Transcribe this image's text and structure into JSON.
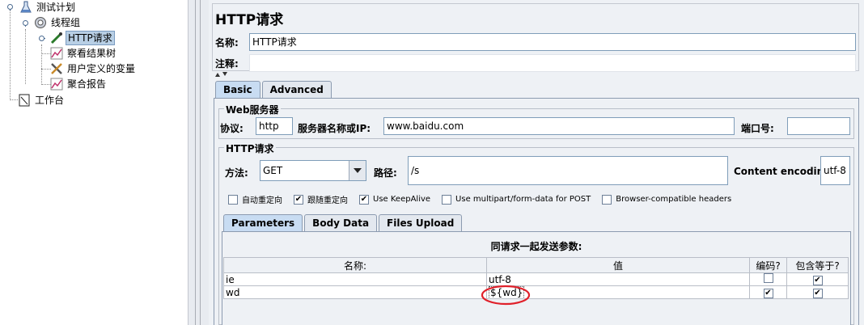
{
  "tree": {
    "items": [
      {
        "label": "测试计划",
        "icon": "flask-icon"
      },
      {
        "label": "线程组",
        "icon": "gear-icon"
      },
      {
        "label": "HTTP请求",
        "icon": "pipette-icon"
      },
      {
        "label": "察看结果树",
        "icon": "graph-icon"
      },
      {
        "label": "用户定义的变量",
        "icon": "tools-icon"
      },
      {
        "label": "聚合报告",
        "icon": "graph-icon"
      },
      {
        "label": "工作台",
        "icon": "clipboard-icon"
      }
    ]
  },
  "panel": {
    "title": "HTTP请求",
    "name_label": "名称:",
    "name_value": "HTTP请求",
    "comment_label": "注释:",
    "tabs": [
      "Basic",
      "Advanced"
    ],
    "web_server": {
      "title": "Web服务器",
      "protocol_label": "协议:",
      "protocol_value": "http",
      "server_label": "服务器名称或IP:",
      "server_value": "www.baidu.com",
      "port_label": "端口号:",
      "port_value": ""
    },
    "http_request": {
      "title": "HTTP请求",
      "method_label": "方法:",
      "method_value": "GET",
      "path_label": "路径:",
      "path_value": "/s",
      "encoding_label": "Content encoding:",
      "encoding_value": "utf-8"
    },
    "options": [
      {
        "label": "自动重定向",
        "checked": false
      },
      {
        "label": "跟随重定向",
        "checked": true
      },
      {
        "label": "Use KeepAlive",
        "checked": true
      },
      {
        "label": "Use multipart/form-data for POST",
        "checked": false
      },
      {
        "label": "Browser-compatible headers",
        "checked": false
      }
    ],
    "sub_tabs": [
      "Parameters",
      "Body Data",
      "Files Upload"
    ],
    "params_caption": "同请求一起发送参数:",
    "columns": [
      "名称:",
      "值",
      "编码?",
      "包含等于?"
    ],
    "rows": [
      {
        "name": "ie",
        "value": "utf-8",
        "encode": false,
        "include_equals": true
      },
      {
        "name": "wd",
        "value": "${wd}",
        "encode": true,
        "include_equals": true
      }
    ],
    "highlight_color": "#e0202a"
  }
}
